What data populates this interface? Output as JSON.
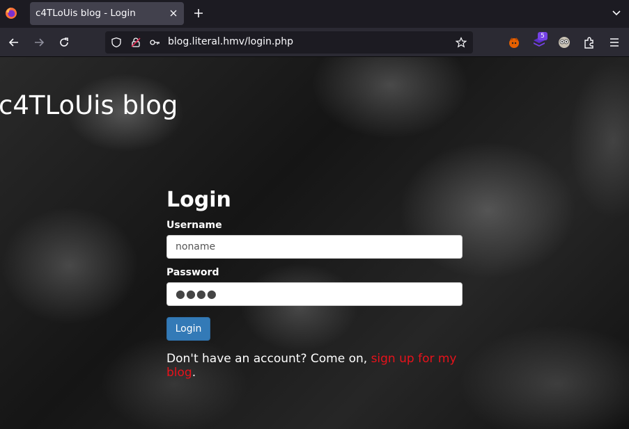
{
  "browser": {
    "tab_title": "c4TLoUis blog - Login",
    "url": "blog.literal.hmv/login.php",
    "extension_badge": "5"
  },
  "page": {
    "blog_title": "c4TLoUis blog",
    "form": {
      "heading": "Login",
      "username_label": "Username",
      "username_value": "noname",
      "password_label": "Password",
      "password_masked": "●●●●",
      "submit_label": "Login"
    },
    "signup": {
      "prefix": "Don't have an account? Come on, ",
      "link_text": "sign up for my blog",
      "suffix": "."
    }
  },
  "colors": {
    "tab_bg": "#42414d",
    "navbar_bg": "#2b2a33",
    "button_primary": "#337ab7",
    "link": "#e8121b"
  }
}
